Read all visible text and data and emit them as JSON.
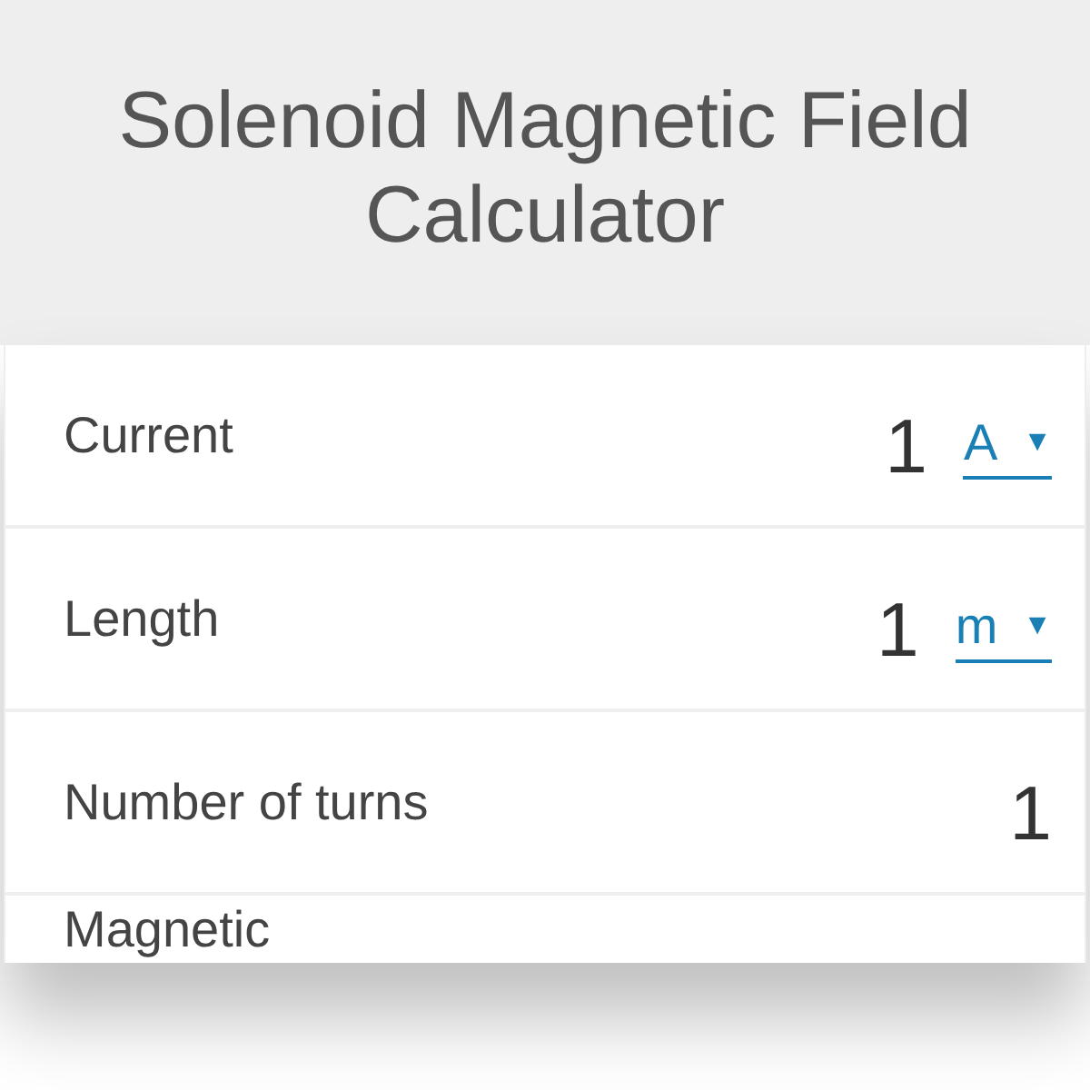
{
  "header": {
    "title": "Solenoid Magnetic Field Calculator"
  },
  "rows": [
    {
      "kind": "unit",
      "label": "Current",
      "value": "1",
      "unit": "A",
      "caret": "▼"
    },
    {
      "kind": "unit",
      "label": "Length",
      "value": "1",
      "unit": "m",
      "caret": "▼"
    },
    {
      "kind": "plain",
      "label": "Number of turns",
      "value": "1"
    },
    {
      "kind": "cut",
      "label": "Magnetic"
    }
  ]
}
